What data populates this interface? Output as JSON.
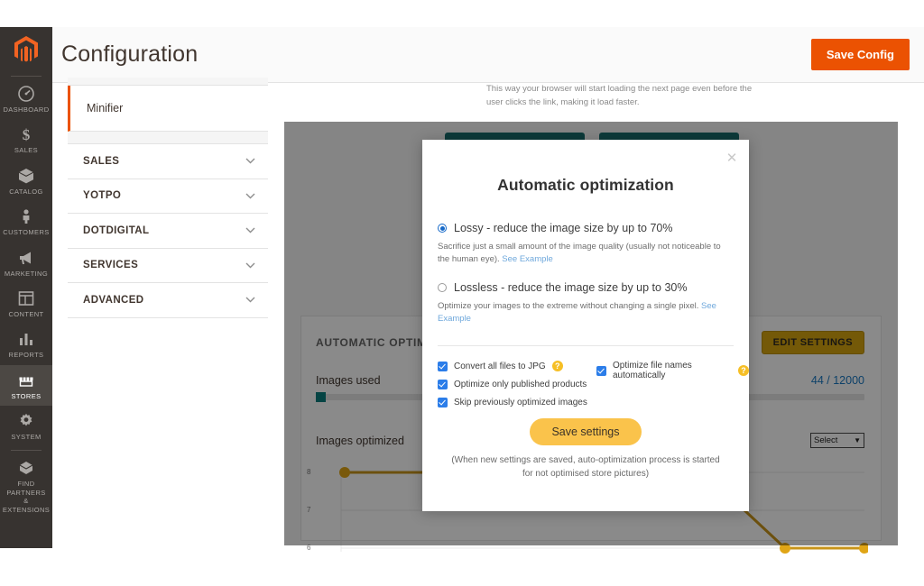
{
  "adminnav": {
    "logo_name": "magento-logo",
    "items": [
      {
        "label": "DASHBOARD",
        "icon": "dashboard-icon",
        "active": false
      },
      {
        "label": "SALES",
        "icon": "dollar-icon",
        "active": false
      },
      {
        "label": "CATALOG",
        "icon": "box-icon",
        "active": false
      },
      {
        "label": "CUSTOMERS",
        "icon": "person-icon",
        "active": false
      },
      {
        "label": "MARKETING",
        "icon": "megaphone-icon",
        "active": false
      },
      {
        "label": "CONTENT",
        "icon": "layout-icon",
        "active": false
      },
      {
        "label": "REPORTS",
        "icon": "bar-chart-icon",
        "active": false
      },
      {
        "label": "STORES",
        "icon": "store-icon",
        "active": true
      },
      {
        "label": "SYSTEM",
        "icon": "gear-icon",
        "active": false
      },
      {
        "label": "FIND PARTNERS\n& EXTENSIONS",
        "icon": "extensions-icon",
        "active": false
      }
    ]
  },
  "header": {
    "title": "Configuration",
    "save_config_label": "Save Config",
    "accent": "#eb5202"
  },
  "config_menu": {
    "active_item": "Minifier",
    "sections": [
      {
        "label": "SALES"
      },
      {
        "label": "YOTPO"
      },
      {
        "label": "DOTDIGITAL"
      },
      {
        "label": "SERVICES"
      },
      {
        "label": "ADVANCED"
      }
    ]
  },
  "background": {
    "help_text": "This way your browser will start loading the next page even before the user clicks the link, making it load faster.",
    "card": {
      "title": "AUTOMATIC OPTIMIZATION",
      "edit_button": "EDIT SETTINGS",
      "images_used_label": "Images used",
      "images_used_value": "44 / 12000",
      "images_optimized_label": "Images optimized",
      "select_value": "Select"
    }
  },
  "chart_data": {
    "type": "line",
    "title": "Images optimized",
    "xlabel": "",
    "ylabel": "",
    "ylim": [
      6,
      8
    ],
    "yticks": [
      "8",
      "7",
      "6"
    ],
    "x": [
      0,
      1,
      2,
      3,
      4,
      5
    ],
    "values": [
      8,
      8,
      8,
      8,
      6,
      6
    ],
    "series_color": "#c8941a",
    "grid": true,
    "legend": ""
  },
  "modal": {
    "title": "Automatic optimization",
    "close_icon": "close-icon",
    "options": [
      {
        "id": "lossy",
        "label": "Lossy - reduce the image size by up to 70%",
        "selected": true,
        "desc": "Sacrifice just a small amount of the image quality (usually not noticeable to the human eye).",
        "link": "See Example"
      },
      {
        "id": "lossless",
        "label": "Lossless - reduce the image size by up to 30%",
        "selected": false,
        "desc": "Optimize your images to the extreme without changing a single pixel.",
        "link": "See Example"
      }
    ],
    "checkboxes": {
      "convert_jpg": {
        "label": "Convert all files to JPG",
        "checked": true,
        "help": "?"
      },
      "optimize_names": {
        "label": "Optimize file names automatically",
        "checked": true,
        "help": "?"
      },
      "only_published": {
        "label": "Optimize only published products",
        "checked": true
      },
      "skip_previously": {
        "label": "Skip previously optimized images",
        "checked": true
      }
    },
    "save_label": "Save settings",
    "note": "(When new settings are saved, auto-optimization process is started for not optimised store pictures)"
  }
}
